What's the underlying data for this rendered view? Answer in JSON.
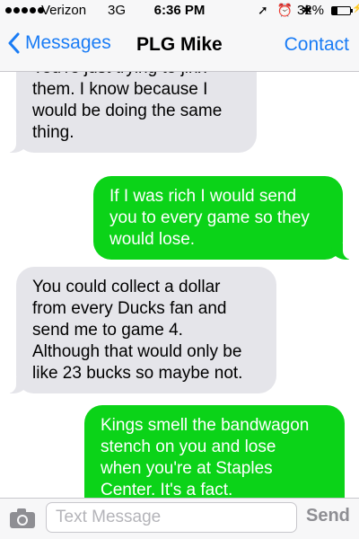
{
  "status_bar": {
    "carrier": "Verizon",
    "network": "3G",
    "time": "6:36 PM",
    "icons": "➚ ⏰ ✱",
    "battery_percent": "32%",
    "battery_level": 0.32,
    "charging_icon": "⚡"
  },
  "nav": {
    "back_label": "Messages",
    "title": "PLG Mike",
    "contact_label": "Contact"
  },
  "messages": [
    {
      "direction": "incoming",
      "text": "You're just trying to jinx\nthem.  I know because I\nwould be doing the same\nthing."
    },
    {
      "direction": "outgoing",
      "text": "If I was rich I would send\nyou to every game so they\nwould lose."
    },
    {
      "direction": "incoming",
      "text": "You could collect a dollar\nfrom every Ducks fan and\nsend me to game 4.\nAlthough that would only be\nlike 23 bucks so maybe not."
    },
    {
      "direction": "outgoing",
      "text": "Kings smell the bandwagon\nstench on you and lose\nwhen you're at Staples\nCenter. It's a fact."
    }
  ],
  "composer": {
    "placeholder": "Text Message",
    "value": "",
    "send_label": "Send"
  },
  "colors": {
    "accent_blue": "#1a7cf5",
    "sent_bubble": "#0bd318",
    "received_bubble": "#e5e5ea"
  },
  "icons": {
    "back": "chevron-left-icon",
    "camera": "camera-icon"
  }
}
